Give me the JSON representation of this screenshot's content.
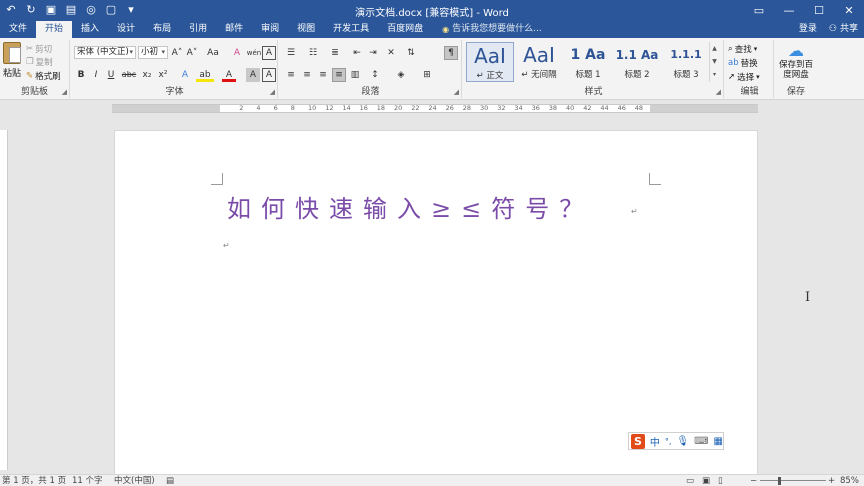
{
  "window": {
    "title": "演示文档.docx [兼容模式] - Word",
    "controls": [
      "▭",
      "—",
      "☐",
      "✕"
    ]
  },
  "qat": {
    "icons": [
      "undo-icon",
      "redo-icon",
      "save-icon",
      "format-painter-icon",
      "print-preview-icon",
      "new-doc-icon",
      "customize-icon"
    ],
    "glyphs": [
      "↶",
      "↻",
      "▣",
      "▤",
      "◎",
      "▢",
      "▾"
    ]
  },
  "tabs": [
    {
      "label": "文件"
    },
    {
      "label": "开始"
    },
    {
      "label": "插入"
    },
    {
      "label": "设计"
    },
    {
      "label": "布局"
    },
    {
      "label": "引用"
    },
    {
      "label": "邮件"
    },
    {
      "label": "审阅"
    },
    {
      "label": "视图"
    },
    {
      "label": "开发工具"
    },
    {
      "label": "百度网盘"
    }
  ],
  "active_tab": "开始",
  "tellme": {
    "icon": "lightbulb-icon",
    "glyph": "💡",
    "text": "告诉我您想要做什么..."
  },
  "account": {
    "login": "登录",
    "share": "共享",
    "share_icon": "person-icon"
  },
  "clipboard": {
    "label": "剪贴板",
    "paste": "粘贴",
    "cut": "剪切",
    "copy": "复制",
    "format_painter": "格式刷"
  },
  "font": {
    "label": "字体",
    "name": "宋体 (中文正)",
    "size": "小初",
    "grow": "A˄",
    "shrink": "A˅",
    "case": "Aa",
    "clear": "A",
    "wen": "wén",
    "bold": "B",
    "italic": "I",
    "underline": "U",
    "strike": "abc",
    "sub": "x₂",
    "sup": "x²",
    "effects": "A",
    "highlight": "ab",
    "color": "A",
    "shade": "A",
    "border": "A",
    "colors": {
      "font_red": "#e01010",
      "highlight_yellow": "#f5e50a"
    }
  },
  "paragraph": {
    "label": "段落"
  },
  "styles": {
    "label": "样式",
    "items": [
      {
        "sample": "AaI",
        "name": "↵ 正文",
        "selected": true
      },
      {
        "sample": "AaI",
        "name": "↵ 无间隔",
        "selected": false
      },
      {
        "sample": "1 Aa",
        "name": "标题 1",
        "selected": false
      },
      {
        "sample": "1.1 Aa",
        "name": "标题 2",
        "selected": false
      },
      {
        "sample": "1.1.1",
        "name": "标题 3",
        "selected": false
      }
    ]
  },
  "editing": {
    "label": "编辑",
    "find": "查找",
    "replace": "替换",
    "select": "选择"
  },
  "save_group": {
    "label": "保存",
    "btn": "保存到百度网盘"
  },
  "ruler": {
    "numbers": [
      "2",
      "4",
      "6",
      "8",
      "10",
      "12",
      "14",
      "16",
      "18",
      "20",
      "22",
      "24",
      "26",
      "28",
      "30",
      "32",
      "34",
      "36",
      "38",
      "40",
      "42",
      "44",
      "46",
      "48"
    ]
  },
  "document": {
    "heading": "如何快速输入≥≤符号？",
    "heading_color": "#7a4ba8",
    "para_mark": "↵"
  },
  "ime": {
    "logo": "S",
    "lang": "中",
    "punct": "°,",
    "icons": [
      "microphone-icon",
      "keyboard-icon",
      "skin-icon"
    ]
  },
  "status": {
    "page": "第 1 页，共 1 页",
    "words": "11 个字",
    "lang": "中文(中国)",
    "zoom": "85%",
    "zoom_minus": "−",
    "zoom_plus": "+"
  }
}
